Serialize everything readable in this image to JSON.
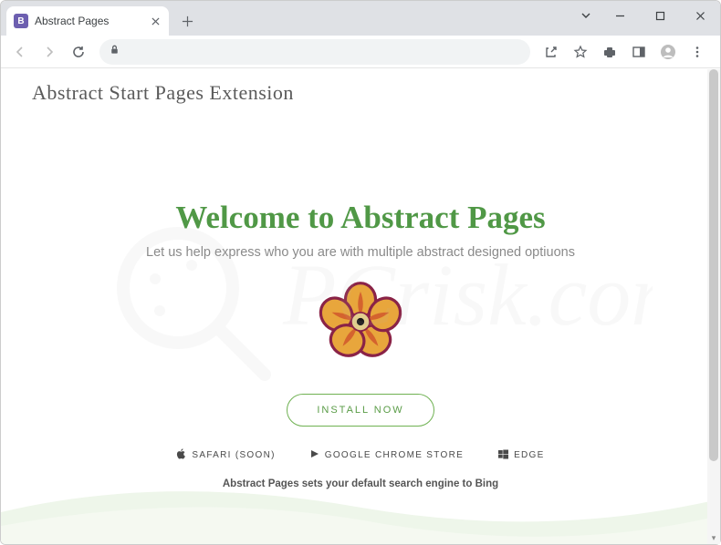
{
  "window": {
    "tab_title": "Abstract Pages",
    "favicon_letter": "B"
  },
  "page": {
    "header": "Abstract Start Pages Extension",
    "hero_title": "Welcome to Abstract Pages",
    "hero_subtitle": "Let us help express who you are with multiple abstract designed optiuons",
    "install_label": "INSTALL NOW",
    "links": {
      "safari": "SAFARI (SOON)",
      "chrome": "GOOGLE CHROME STORE",
      "edge": "EDGE"
    },
    "footnote": "Abstract Pages sets your default search engine to Bing"
  },
  "colors": {
    "accent_green": "#509846",
    "border_green": "#6fb152"
  }
}
